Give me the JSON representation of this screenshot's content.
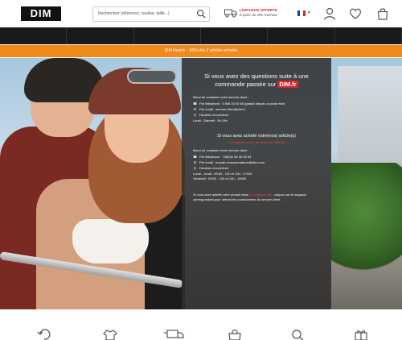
{
  "header": {
    "logo": "DIM",
    "search_placeholder": "Recherchez (référence, couleur, taille...)",
    "delivery_title": "LIVRAISON OFFERTE",
    "delivery_sub": "à partir de 29€ d'achats",
    "flag_caret": "▼",
    "icons": [
      "search-icon",
      "truck-icon",
      "france-flag-icon",
      "account-icon",
      "heart-icon",
      "cart-icon"
    ]
  },
  "promo": {
    "text": "DIM Hearts : -50% dès 2 articles achetés"
  },
  "panel": {
    "heading1": "Si vous avez des questions suite à une commande passée sur",
    "site": "DIM.fr",
    "contact_intro": "Merci de contacter notre service client :",
    "phone": "Par téléphone : 0 806 16 00 66 (gratuit depuis un poste fixe)",
    "email": "Par email : service-client@dim.fr",
    "hours_title": "Horaires d'ouverture :",
    "hours": "Lundi - Samedi : 9h-19h",
    "heading2": "Si vous avez acheté votre(vos) article(s)",
    "store_text": "en magasin ou sur un autre site internet",
    "store_intro": "Merci de contacter notre service client :",
    "store_phone": "Par téléphone : +33(0)1 80 40 82 94",
    "store_email": "Par email : ecoute.consommateurs@dim.com",
    "store_hours_title": "Horaires d'ouverture :",
    "store_hours1": "Lundi - Jeudi : 09:00 - 12h et 13h - 17h00",
    "store_hours2": "Vendredi : 09:00 - 12h et 13h - 16h00",
    "footer_a": "Si vous avez acheté votre produit dans ",
    "footer_link": "un magasin DIM",
    "footer_b": ", cliquez sur le magasin correspondant pour obtenir les coordonnées du service client."
  },
  "bottom_icons": [
    "return-icon",
    "shirt-icon",
    "delivery-icon",
    "bag-icon",
    "search-store-icon",
    "gift-icon"
  ]
}
